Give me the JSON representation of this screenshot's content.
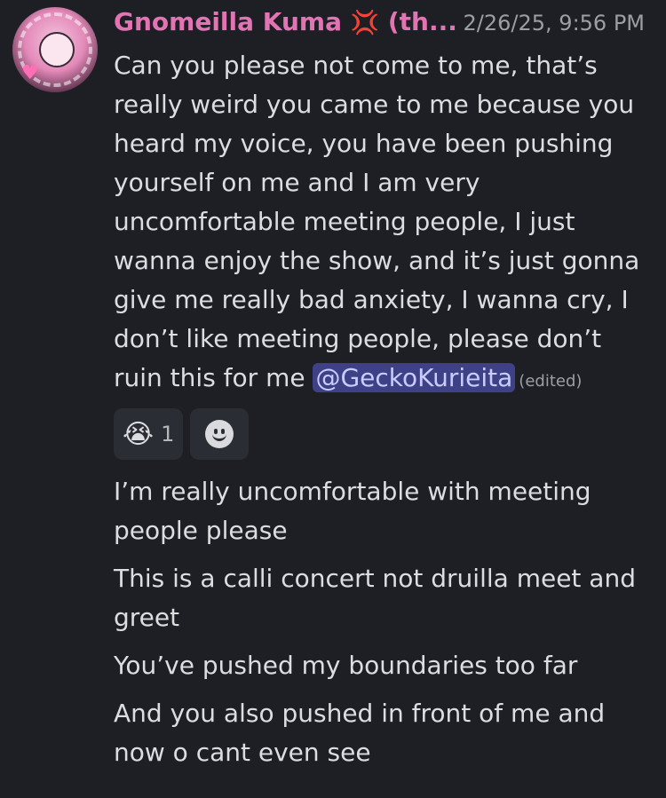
{
  "author": {
    "name": "Gnomeilla Kuma",
    "emoji": "💢",
    "suffix": "(th...",
    "name_color": "#e374b3"
  },
  "timestamp": "2/26/25, 9:56 PM",
  "message_1": {
    "text": "Can you please not come to me, that’s really weird you came to me because you heard my voice, you have been pushing yourself on me and I am very uncomfortable meeting people, I just wanna enjoy the show, and it’s just gonna give me really bad anxiety, I wanna cry, I don’t like meeting people, please don’t ruin this for me ",
    "mention": "@GeckoKurieita",
    "edited_label": "(edited)"
  },
  "reactions": [
    {
      "emoji": "😭",
      "count": "1"
    }
  ],
  "add_reaction_icon": "add-reaction-smile-icon",
  "messages": [
    "I’m really uncomfortable with meeting people please",
    "This is a calli concert not druilla meet and greet",
    "You’ve pushed my boundaries too far",
    "And you also pushed in front of me and now o cant even see"
  ]
}
